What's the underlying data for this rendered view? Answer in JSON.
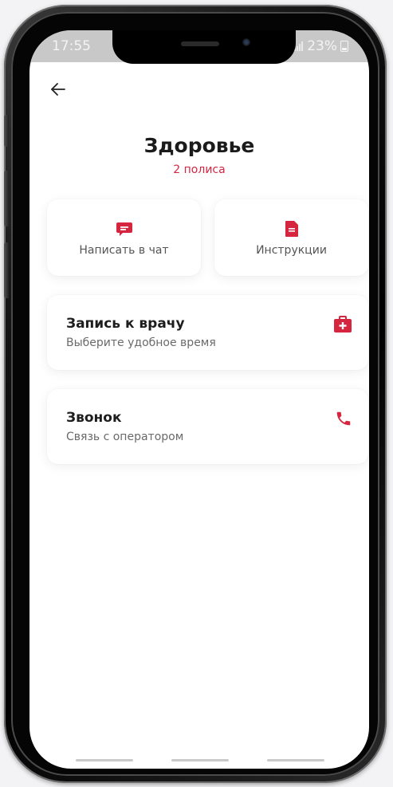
{
  "status_bar": {
    "time": "17:55",
    "battery": "23%"
  },
  "header": {
    "back_icon": "arrow-left-icon",
    "title": "Здоровье",
    "subtitle": "2 полиса"
  },
  "tiles": [
    {
      "label": "Написать в чат",
      "icon": "chat-icon"
    },
    {
      "label": "Инструкции",
      "icon": "document-icon"
    }
  ],
  "cards": [
    {
      "title": "Запись к врачу",
      "subtitle": "Выберите удобное время",
      "icon": "medical-kit-icon"
    },
    {
      "title": "Звонок",
      "subtitle": "Связь с оператором",
      "icon": "phone-icon"
    }
  ],
  "colors": {
    "accent": "#d6263f",
    "screen_bg": "#ffffff",
    "status_bar_bg": "#c8c8c8",
    "frame": "#000000"
  }
}
